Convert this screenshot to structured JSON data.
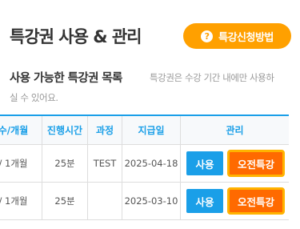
{
  "page": {
    "title": "특강권 사용 & 관리",
    "how_to_apply_button": "특강신청방법",
    "help_icon_glyph": "?"
  },
  "list": {
    "heading": "사용 가능한 특강권 목록",
    "note_part1": "특강권은 수강 기간 내에만 사용하",
    "note_part2": "실 수 있어요."
  },
  "table": {
    "columns": [
      "수/개월",
      "진행시간",
      "과정",
      "지급일",
      "관리"
    ],
    "rows": [
      {
        "period": "/ 1개월",
        "duration": "25분",
        "course": "TEST",
        "issued_date": "2025-04-18",
        "use_label": "사용",
        "special_label": "오전특강"
      },
      {
        "period": "/ 1개월",
        "duration": "25분",
        "course": "",
        "issued_date": "2025-03-10",
        "use_label": "사용",
        "special_label": "오전특강"
      }
    ]
  },
  "colors": {
    "accent_blue": "#1a9fe8",
    "orange_button": "#ffa000",
    "special_button": "#ff6a00",
    "special_border": "#ffb300"
  }
}
